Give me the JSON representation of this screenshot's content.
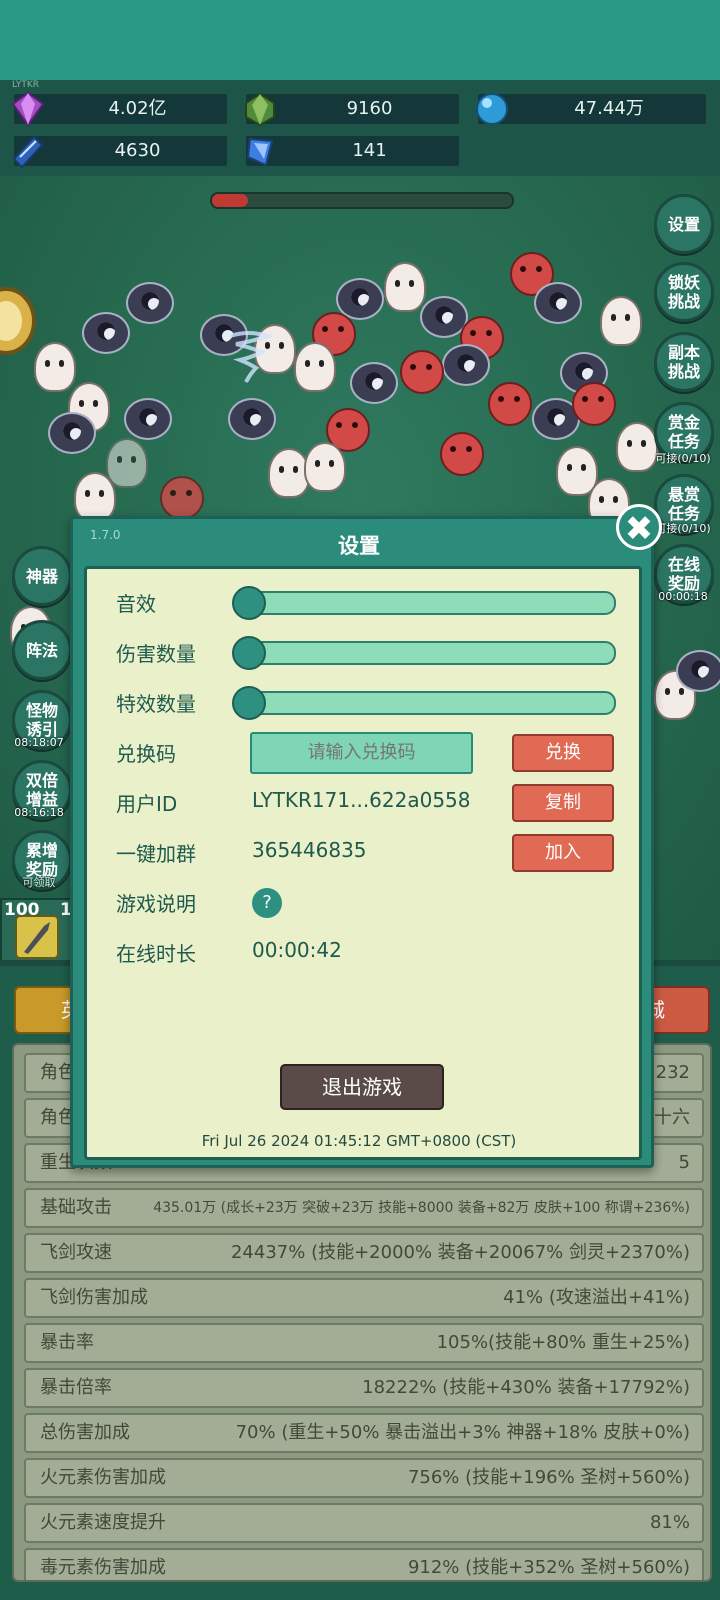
{
  "hud": {
    "version_tiny": "LYTKR",
    "resources": [
      {
        "icon": "purple-gem-icon",
        "value": "4.02亿",
        "color": "#a34ec4"
      },
      {
        "icon": "green-crystal-icon",
        "value": "9160",
        "color": "#4f8a3a"
      },
      {
        "icon": "blue-orb-icon",
        "value": "47.44万",
        "color": "#2f9bd6"
      },
      {
        "icon": "blue-book-icon",
        "value": "4630",
        "color": "#2c63b8"
      },
      {
        "icon": "blue-shard-icon",
        "value": "141",
        "color": "#3d7fe0"
      }
    ],
    "wave_progress": 0.12
  },
  "side_left": {
    "artifact": "神器",
    "formation": "阵法",
    "lure": "怪物诱引",
    "lure_timer": "08:18:07",
    "double": "双倍增益",
    "double_timer": "08:16:18",
    "accum": "累增奖励",
    "accum_status": "可领取"
  },
  "side_right": {
    "settings": "设置",
    "demon_challenge": "锁妖挑战",
    "dungeon_challenge": "副本挑战",
    "bounty_task": "赏金任务",
    "bounty_count": "可接(0/10)",
    "reward_task": "悬赏任务",
    "reward_count": "可接(0/10)",
    "online_reward": "在线奖励",
    "online_timer": "00:00:18"
  },
  "skill_slot": {
    "level": "100",
    "level2": "1"
  },
  "tabs": {
    "left": "英",
    "right": "城"
  },
  "stats": [
    {
      "label": "角色",
      "value": "232"
    },
    {
      "label": "角色",
      "value": "十六"
    },
    {
      "label": "重生次数",
      "value": "5"
    },
    {
      "label": "基础攻击",
      "value": "435.01万 (成长+23万 突破+23万 技能+8000 装备+82万 皮肤+100 称谓+236%)"
    },
    {
      "label": "飞剑攻速",
      "value": "24437% (技能+2000% 装备+20067% 剑灵+2370%)"
    },
    {
      "label": "飞剑伤害加成",
      "value": "41% (攻速溢出+41%)"
    },
    {
      "label": "暴击率",
      "value": "105%(技能+80% 重生+25%)"
    },
    {
      "label": "暴击倍率",
      "value": "18222% (技能+430% 装备+17792%)"
    },
    {
      "label": "总伤害加成",
      "value": "70% (重生+50% 暴击溢出+3% 神器+18% 皮肤+0%)"
    },
    {
      "label": "火元素伤害加成",
      "value": "756% (技能+196% 圣树+560%)"
    },
    {
      "label": "火元素速度提升",
      "value": "81%"
    },
    {
      "label": "毒元素伤害加成",
      "value": "912% (技能+352% 圣树+560%)"
    }
  ],
  "modal": {
    "version": "1.7.0",
    "title": "设置",
    "sound_label": "音效",
    "sound_level": 0.0,
    "damage_label": "伤害数量",
    "damage_level": 0.0,
    "effects_label": "特效数量",
    "effects_level": 0.0,
    "redeem_label": "兑换码",
    "redeem_placeholder": "请输入兑换码",
    "redeem_button": "兑换",
    "userid_label": "用户ID",
    "userid_value": "LYTKR171...622a0558",
    "copy_button": "复制",
    "group_label": "一键加群",
    "group_value": "365446835",
    "join_button": "加入",
    "help_label": "游戏说明",
    "help_glyph": "?",
    "online_label": "在线时长",
    "online_value": "00:00:42",
    "exit_button": "退出游戏",
    "timestamp": "Fri Jul 26 2024 01:45:12 GMT+0800 (CST)",
    "close_glyph": "✖"
  }
}
